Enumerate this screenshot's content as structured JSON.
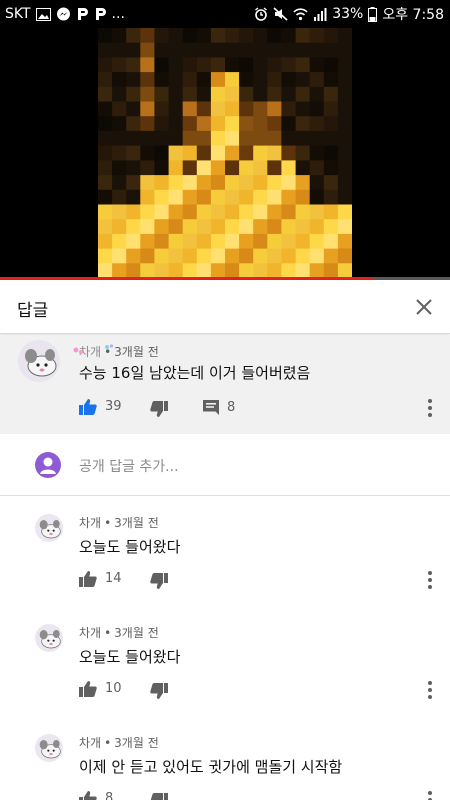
{
  "status_bar": {
    "carrier": "SKT",
    "icons_left": [
      "image-icon",
      "messenger-icon",
      "p-icon",
      "p-icon"
    ],
    "dots": "...",
    "battery_percent": "33%",
    "time": "오후 7:58"
  },
  "video": {
    "progress": 0.83,
    "colors": {
      "progress": "#e62117",
      "track": "#5a5a5a"
    }
  },
  "panel": {
    "title": "답글"
  },
  "parent_comment": {
    "author": "차개",
    "time": "3개월 전",
    "text": "수능 16일 남았는데 이거 들어버렸음",
    "likes": "39",
    "replies": "8"
  },
  "add_reply": {
    "placeholder": "공개 답글 추가..."
  },
  "replies": [
    {
      "author": "차개",
      "time": "3개월 전",
      "text": "오늘도 들어왔다",
      "likes": "14"
    },
    {
      "author": "차개",
      "time": "3개월 전",
      "text": "오늘도 들어왔다",
      "likes": "10"
    },
    {
      "author": "차개",
      "time": "3개월 전",
      "text": "이제 안 듣고 있어도 귓가에 맴돌기 시작함",
      "likes": "8"
    }
  ],
  "colors": {
    "like_active": "#1a73e8",
    "icon_gray": "#606060",
    "avatar_purple": "#8e5bd4"
  }
}
